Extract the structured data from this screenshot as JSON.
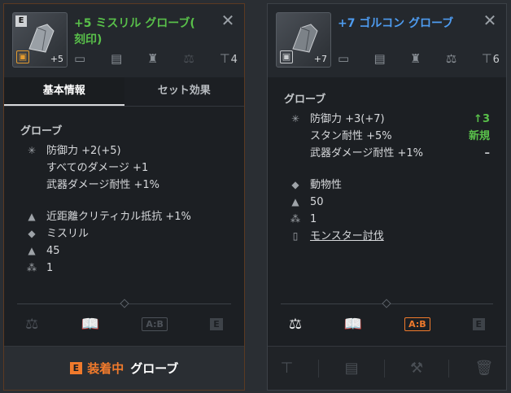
{
  "left": {
    "item_name_line1": "+5 ミスリル グローブ(",
    "item_name_line2": "刻印)",
    "enhance": "+5",
    "stack_count": "4",
    "tabs": [
      "基本情報",
      "セット効果"
    ],
    "category": "グローブ",
    "stats": [
      "防御力 +2(+5)",
      "すべてのダメージ +1",
      "武器ダメージ耐性 +1%"
    ],
    "special": "近距離クリティカル抵抗 +1%",
    "material": "ミスリル",
    "weight": "45",
    "level": "1",
    "equip_label": "装着中",
    "equip_item": "グローブ",
    "colors": {
      "name": "#59c04a",
      "accent": "#f07a2c"
    }
  },
  "right": {
    "item_name": "+7 ゴルコン グローブ",
    "enhance": "+7",
    "stack_count": "6",
    "category": "グローブ",
    "stats": [
      {
        "label": "防御力 +3(+7)",
        "delta": "↑3"
      },
      {
        "label": "スタン耐性 +5%",
        "delta": "新規"
      },
      {
        "label": "武器ダメージ耐性 +1%",
        "delta": "–"
      }
    ],
    "material": "動物性",
    "weight": "50",
    "level": "1",
    "source_link": "モンスター討伐",
    "colors": {
      "name": "#4e9cf0",
      "delta": "#59c04a"
    }
  }
}
